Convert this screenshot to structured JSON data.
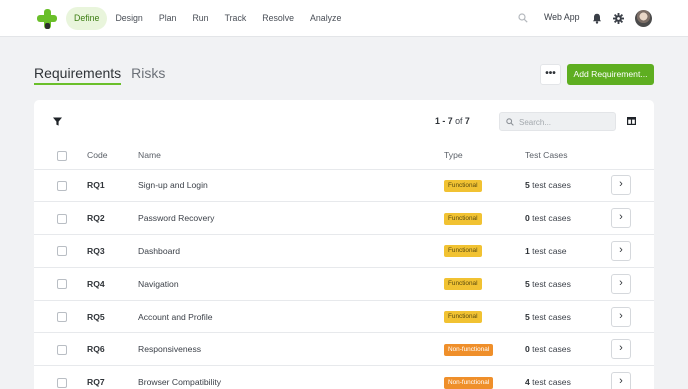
{
  "nav": {
    "items": [
      {
        "label": "Define",
        "active": true
      },
      {
        "label": "Design",
        "active": false
      },
      {
        "label": "Plan",
        "active": false
      },
      {
        "label": "Run",
        "active": false
      },
      {
        "label": "Track",
        "active": false
      },
      {
        "label": "Resolve",
        "active": false
      },
      {
        "label": "Analyze",
        "active": false
      }
    ],
    "web_app": "Web App"
  },
  "tabs": [
    {
      "label": "Requirements",
      "active": true
    },
    {
      "label": "Risks",
      "active": false
    }
  ],
  "actions": {
    "more_label": "•••",
    "add_label": "Add Requirement..."
  },
  "toolbar": {
    "pager_range": "1 - 7",
    "pager_of": "of",
    "pager_total": "7",
    "search_placeholder": "Search..."
  },
  "table": {
    "headers": {
      "code": "Code",
      "name": "Name",
      "type": "Type",
      "test_cases": "Test Cases"
    },
    "rows": [
      {
        "code": "RQ1",
        "name": "Sign-up and Login",
        "type": "Functional",
        "tc_count": "5",
        "tc_label": "test cases"
      },
      {
        "code": "RQ2",
        "name": "Password Recovery",
        "type": "Functional",
        "tc_count": "0",
        "tc_label": "test cases"
      },
      {
        "code": "RQ3",
        "name": "Dashboard",
        "type": "Functional",
        "tc_count": "1",
        "tc_label": "test case"
      },
      {
        "code": "RQ4",
        "name": "Navigation",
        "type": "Functional",
        "tc_count": "5",
        "tc_label": "test cases"
      },
      {
        "code": "RQ5",
        "name": "Account and Profile",
        "type": "Functional",
        "tc_count": "5",
        "tc_label": "test cases"
      },
      {
        "code": "RQ6",
        "name": "Responsiveness",
        "type": "Non-functional",
        "tc_count": "0",
        "tc_label": "test cases"
      },
      {
        "code": "RQ7",
        "name": "Browser Compatibility",
        "type": "Non-functional",
        "tc_count": "4",
        "tc_label": "test cases"
      }
    ]
  },
  "colors": {
    "brand": "#6abf2a",
    "primary_button": "#5eae20",
    "functional_badge": "#f1c232",
    "nonfunctional_badge": "#ef8f2a"
  }
}
